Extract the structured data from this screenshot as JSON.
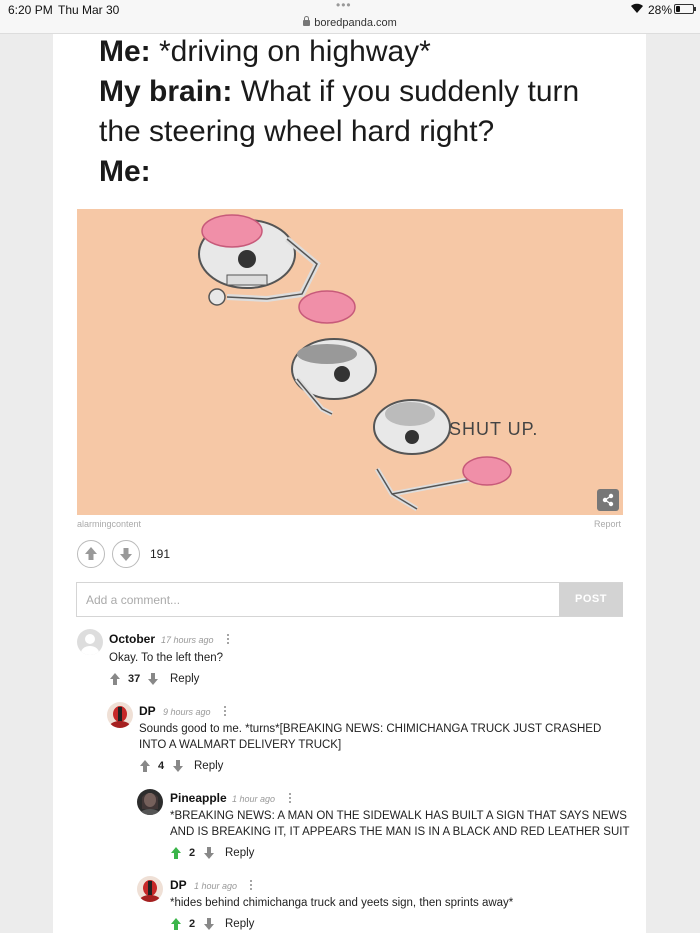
{
  "status_bar": {
    "time": "6:20 PM",
    "date": "Thu Mar 30",
    "url": "boredpanda.com",
    "battery": "28%",
    "battery_level": 0.28
  },
  "meme": {
    "line1_bold": "Me:",
    "line1_text": " *driving on highway*",
    "line2_bold": "My brain:",
    "line2_text": " What if you suddenly turn the steering wheel hard right?",
    "line3_bold": "Me:",
    "image_caption": "SHUT UP.",
    "credit": "alarmingcontent",
    "report_label": "Report"
  },
  "post_votes": {
    "count": "191"
  },
  "comment_form": {
    "placeholder": "Add a comment...",
    "post_label": "POST"
  },
  "comments": [
    {
      "author": "October",
      "time": "17 hours ago",
      "text": "Okay. To the left then?",
      "votes": "37",
      "upvoted": false,
      "reply_label": "Reply"
    },
    {
      "author": "DP",
      "time": "9 hours ago",
      "text": "Sounds good to me. *turns*[BREAKING NEWS: CHIMICHANGA TRUCK JUST CRASHED INTO A WALMART DELIVERY TRUCK]",
      "votes": "4",
      "upvoted": false,
      "reply_label": "Reply"
    },
    {
      "author": "Pineapple",
      "time": "1 hour ago",
      "text": "*BREAKING NEWS: A MAN ON THE SIDEWALK HAS BUILT A SIGN THAT SAYS NEWS AND IS BREAKING IT, IT APPEARS THE MAN IS IN A BLACK AND RED LEATHER SUIT",
      "votes": "2",
      "upvoted": true,
      "reply_label": "Reply"
    },
    {
      "author": "DP",
      "time": "1 hour ago",
      "text": "*hides behind chimichanga truck and yeets sign, then sprints away*",
      "votes": "2",
      "upvoted": true,
      "reply_label": "Reply"
    }
  ],
  "colors": {
    "upvote_active": "#3bb54a",
    "vote_inactive": "#888888",
    "meme_background": "#f6c8a6",
    "brain": "#f08fa8"
  }
}
